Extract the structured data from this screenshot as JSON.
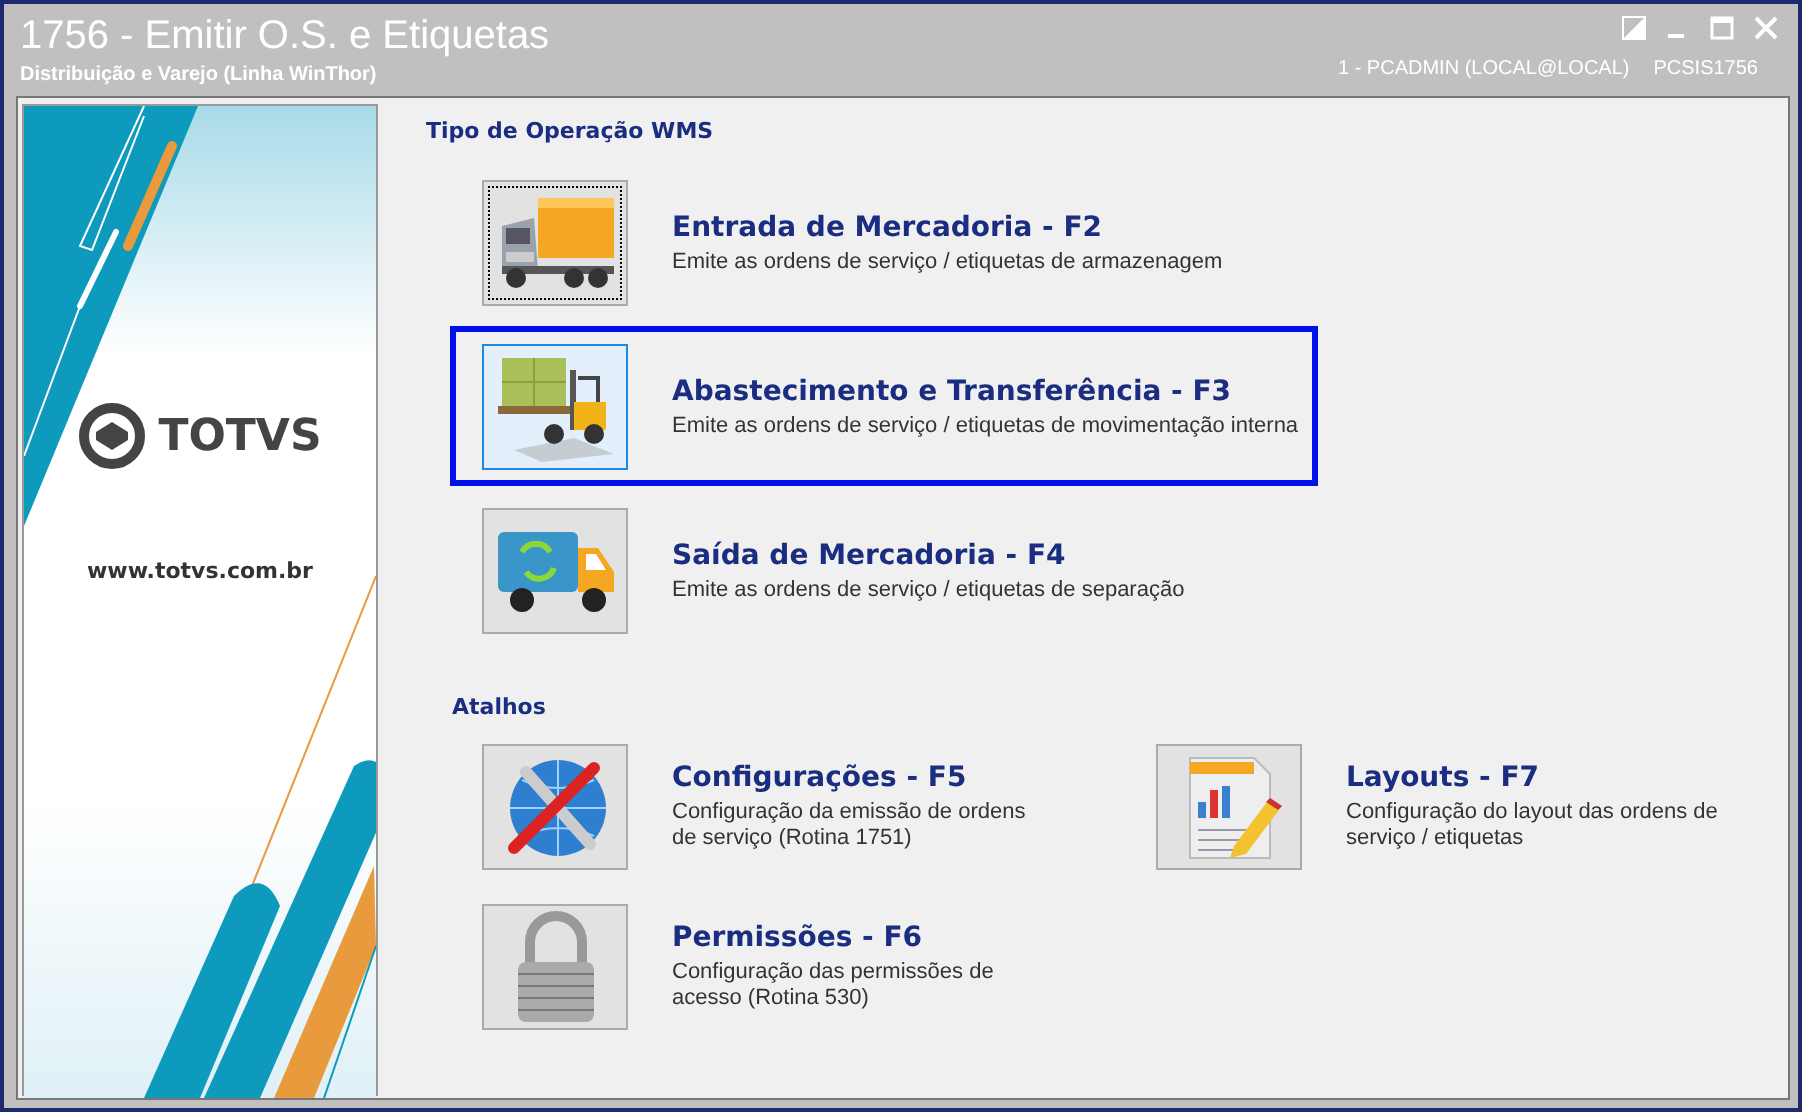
{
  "window": {
    "title": "1756 - Emitir O.S. e Etiquetas",
    "subtitle": "Distribuição e Varejo (Linha WinThor)",
    "user": "1 - PCADMIN (LOCAL@LOCAL)",
    "program": "PCSIS1756"
  },
  "sidebar": {
    "logo_text": "TOTVS",
    "url": "www.totvs.com.br"
  },
  "operations": {
    "title": "Tipo de Operação WMS",
    "items": [
      {
        "kind": "truck",
        "title": "Entrada de Mercadoria - F2",
        "description": "Emite as ordens de serviço / etiquetas de armazenagem",
        "selected": false,
        "focused": true
      },
      {
        "kind": "forklift",
        "title": "Abastecimento e Transferência - F3",
        "description": "Emite as ordens de serviço / etiquetas de movimentação interna",
        "selected": true,
        "focused": false
      },
      {
        "kind": "van",
        "title": "Saída de Mercadoria - F4",
        "description": "Emite as ordens de serviço / etiquetas de separação",
        "selected": false,
        "focused": false
      }
    ]
  },
  "shortcuts": {
    "title": "Atalhos",
    "items": [
      {
        "kind": "tools",
        "title": "Configurações - F5",
        "description": "Configuração da emissão de ordens de serviço (Rotina 1751)"
      },
      {
        "kind": "document",
        "title": "Layouts - F7",
        "description": "Configuração do layout das ordens de serviço / etiquetas"
      },
      {
        "kind": "lock",
        "title": "Permissões - F6",
        "description": "Configuração das permissões de acesso (Rotina 530)"
      }
    ]
  }
}
